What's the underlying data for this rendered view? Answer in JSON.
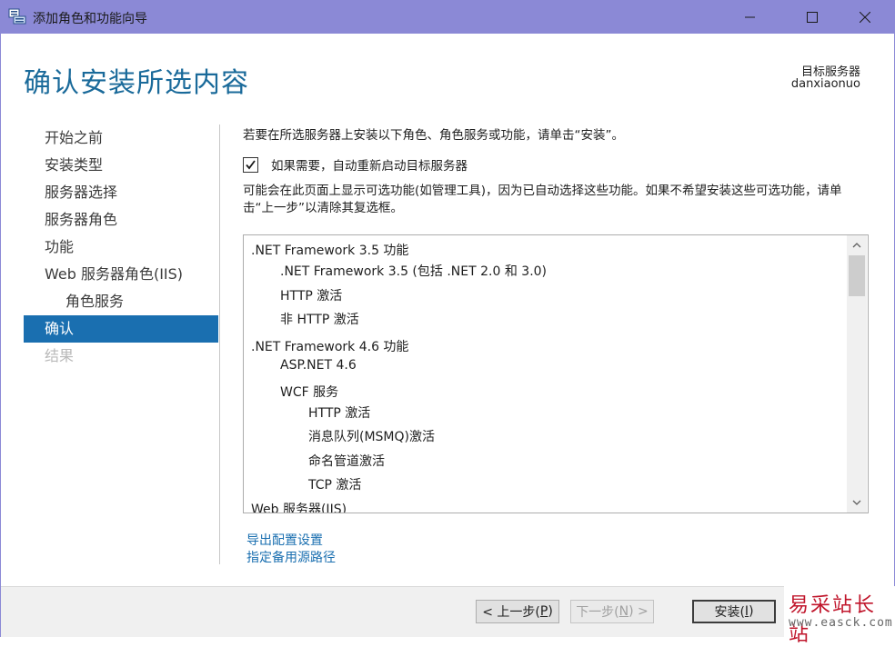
{
  "window": {
    "title": "添加角色和功能向导",
    "minimize_icon": "minimize-icon",
    "maximize_icon": "maximize-icon",
    "close_icon": "close-icon",
    "title_bar_color": "#8b89d6"
  },
  "header": {
    "page_title": "确认安装所选内容",
    "target_label": "目标服务器",
    "target_name": "danxiaonuo"
  },
  "nav": {
    "items": [
      {
        "label": "开始之前",
        "state": "normal"
      },
      {
        "label": "安装类型",
        "state": "normal"
      },
      {
        "label": "服务器选择",
        "state": "normal"
      },
      {
        "label": "服务器角色",
        "state": "normal"
      },
      {
        "label": "功能",
        "state": "normal"
      },
      {
        "label": "Web 服务器角色(IIS)",
        "state": "normal"
      },
      {
        "label": "角色服务",
        "state": "normal",
        "sub": true
      },
      {
        "label": "确认",
        "state": "active"
      },
      {
        "label": "结果",
        "state": "disabled"
      }
    ],
    "active_color": "#1a6fb0"
  },
  "content": {
    "intro": "若要在所选服务器上安装以下角色、角色服务或功能，请单击“安装”。",
    "restart_checkbox": {
      "label": "如果需要，自动重新启动目标服务器",
      "checked": true
    },
    "note": "可能会在此页面上显示可选功能(如管理工具)，因为已自动选择这些功能。如果不希望安装这些可选功能，请单击“上一步”以清除其复选框。",
    "list_items": [
      {
        "text": ".NET Framework 3.5 功能",
        "level": 0
      },
      {
        "text": ".NET Framework 3.5 (包括 .NET 2.0 和 3.0)",
        "level": 1
      },
      {
        "text": "HTTP 激活",
        "level": 1
      },
      {
        "text": "非 HTTP 激活",
        "level": 1
      },
      {
        "text": ".NET Framework 4.6 功能",
        "level": 0
      },
      {
        "text": "ASP.NET 4.6",
        "level": 1
      },
      {
        "text": "WCF 服务",
        "level": 1
      },
      {
        "text": "HTTP 激活",
        "level": 2
      },
      {
        "text": "消息队列(MSMQ)激活",
        "level": 2
      },
      {
        "text": "命名管道激活",
        "level": 2
      },
      {
        "text": "TCP 激活",
        "level": 2
      },
      {
        "text": "Web 服务器(IIS)",
        "level": 0
      }
    ],
    "links": {
      "export": "导出配置设置",
      "alt_source": "指定备用源路径"
    }
  },
  "footer": {
    "prev": {
      "label": "< 上一步(",
      "key": "P",
      "suffix": ")"
    },
    "next": {
      "label": "下一步(",
      "key": "N",
      "suffix": ") >"
    },
    "install": {
      "label": "安装(",
      "key": "I",
      "suffix": ")"
    }
  },
  "watermark": {
    "cn": "易采站长站",
    "url": "www.easck.com"
  }
}
